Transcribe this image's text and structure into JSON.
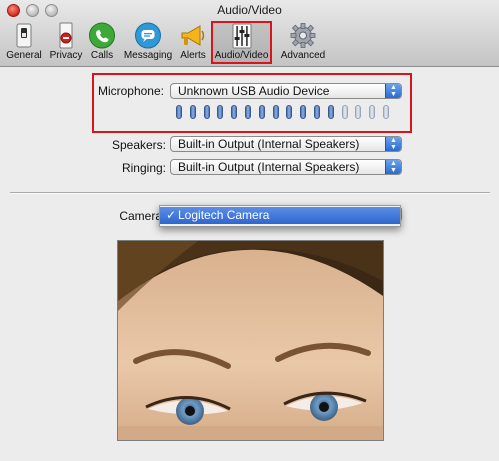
{
  "window": {
    "title": "Audio/Video"
  },
  "toolbar": {
    "items": [
      {
        "label": "General",
        "icon": "general-switch-icon"
      },
      {
        "label": "Privacy",
        "icon": "privacy-icon"
      },
      {
        "label": "Calls",
        "icon": "phone-icon"
      },
      {
        "label": "Messaging",
        "icon": "chat-bubble-icon"
      },
      {
        "label": "Alerts",
        "icon": "megaphone-icon"
      },
      {
        "label": "Audio/Video",
        "icon": "mixer-sliders-icon",
        "selected": true
      },
      {
        "label": "Advanced",
        "icon": "gear-icon"
      }
    ]
  },
  "microphone": {
    "label": "Microphone:",
    "value": "Unknown USB Audio Device",
    "level": {
      "active_segments": 12,
      "total_segments": 16
    }
  },
  "speakers": {
    "label": "Speakers:",
    "value": "Built-in Output (Internal Speakers)"
  },
  "ringing": {
    "label": "Ringing:",
    "value": "Built-in Output (Internal Speakers)"
  },
  "camera": {
    "label": "Camera",
    "menu_options": [
      {
        "label": "Logitech Camera",
        "checked": true,
        "check_glyph": "✓"
      }
    ]
  },
  "colors": {
    "highlight_red": "#d9151b",
    "selection_blue": "#2f66cf"
  }
}
